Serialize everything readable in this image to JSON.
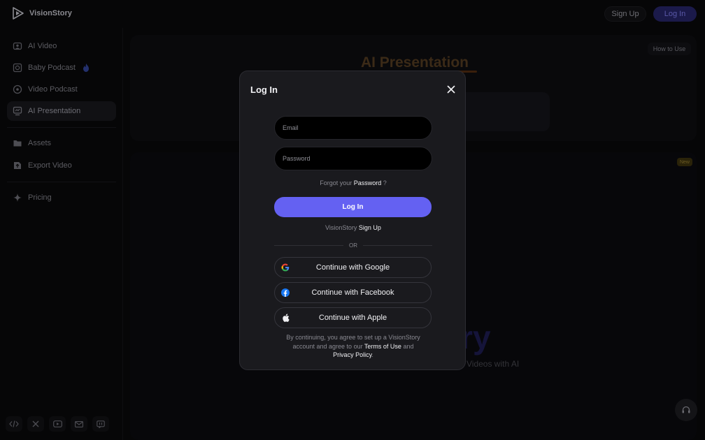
{
  "topbar": {
    "logo_text": "VisionStory",
    "signup_label": "Sign Up",
    "login_label": "Log In"
  },
  "sidebar": {
    "items": [
      {
        "label": "AI Video",
        "icon": "ai-video-icon"
      },
      {
        "label": "Baby Podcast",
        "icon": "baby-icon"
      },
      {
        "label": "Video Podcast",
        "icon": "podcast-icon"
      },
      {
        "label": "AI Presentation",
        "icon": "presentation-icon",
        "active": true
      },
      {
        "label": "Assets",
        "icon": "folder-icon"
      },
      {
        "label": "Export Video",
        "icon": "export-icon"
      },
      {
        "label": "Pricing",
        "icon": "sparkle-icon"
      }
    ],
    "socials": [
      "code-icon",
      "x-icon",
      "youtube-icon",
      "mail-icon",
      "discord-icon"
    ]
  },
  "main": {
    "how_to_use": "How to Use",
    "section_title": "AI Presentation",
    "new_badge": "New",
    "hero_text": "ory",
    "hero_sub": "Videos with AI"
  },
  "modal": {
    "title": "Log In",
    "email_placeholder": "Email",
    "password_placeholder": "Password",
    "forgot_prefix": "Forgot your",
    "forgot_link": "Password",
    "forgot_suffix": "?",
    "login_button": "Log In",
    "signup_prefix": "VisionStory",
    "signup_link": "Sign Up",
    "or_text": "OR",
    "google_label": "Continue with Google",
    "facebook_label": "Continue with Facebook",
    "apple_label": "Continue with Apple",
    "legal_prefix": "By continuing, you agree to set up a VisionStory account and agree to our",
    "terms_link": "Terms of Use",
    "legal_and": "and",
    "privacy_link": "Privacy Policy",
    "legal_end": "."
  },
  "colors": {
    "accent": "#6461f2",
    "modal_bg": "#1a1a1e",
    "page_bg": "#060607"
  }
}
